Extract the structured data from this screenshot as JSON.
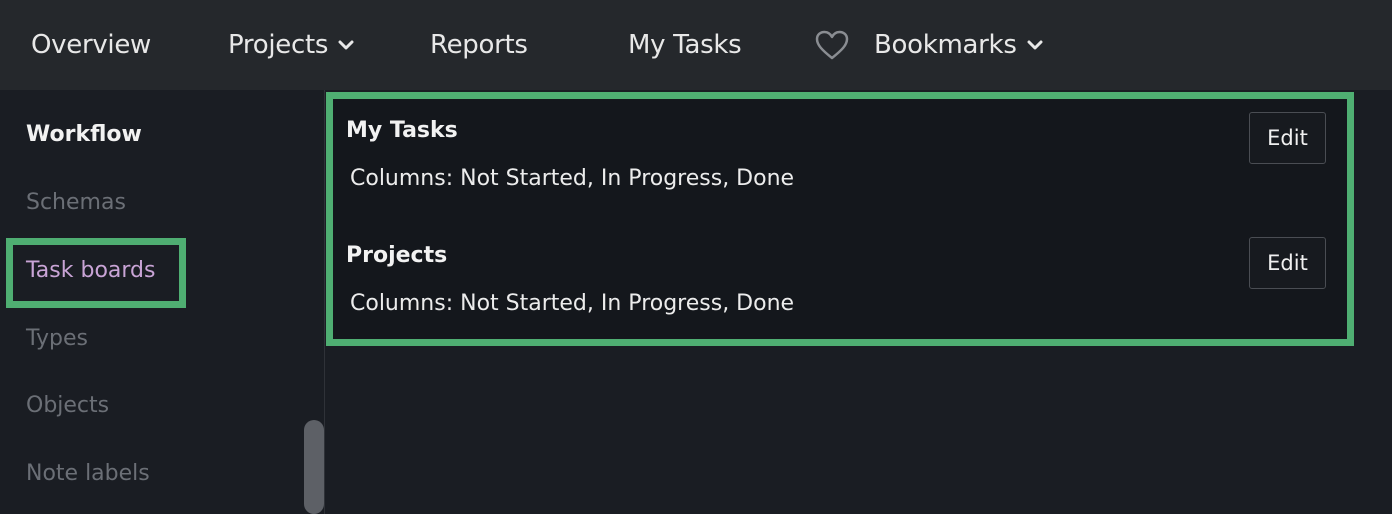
{
  "nav": {
    "overview": "Overview",
    "projects": "Projects",
    "reports": "Reports",
    "my_tasks": "My Tasks",
    "bookmarks": "Bookmarks"
  },
  "sidebar": {
    "heading": "Workflow",
    "items": [
      {
        "label": "Schemas",
        "active": false
      },
      {
        "label": "Task boards",
        "active": true
      },
      {
        "label": "Types",
        "active": false
      },
      {
        "label": "Objects",
        "active": false
      },
      {
        "label": "Note labels",
        "active": false
      }
    ]
  },
  "boards": [
    {
      "title": "My Tasks",
      "columns_text": "Columns: Not Started, In Progress, Done",
      "edit_label": "Edit"
    },
    {
      "title": "Projects",
      "columns_text": "Columns: Not Started, In Progress, Done",
      "edit_label": "Edit"
    }
  ],
  "colors": {
    "highlight": "#4fae72",
    "active_sidebar": "#c9a4d6",
    "topbar_bg": "#25282c"
  },
  "icons": {
    "bookmarks": "heart-icon",
    "dropdown": "chevron-down-icon"
  }
}
